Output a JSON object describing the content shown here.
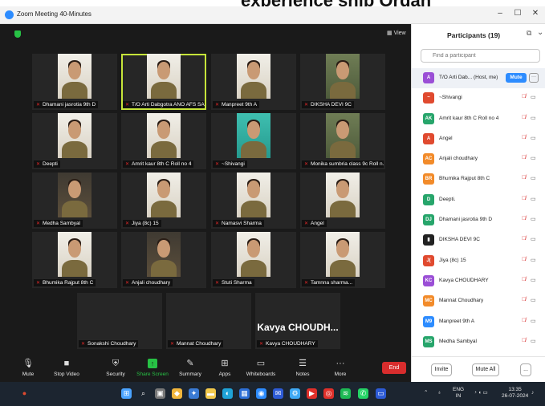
{
  "header_fragment": "experience ship Organ",
  "window": {
    "title": "Zoom Meeting 40-Minutes",
    "controls": [
      "–",
      "☐",
      "✕"
    ]
  },
  "view_label": "View",
  "tiles": [
    {
      "name": "Dhamani jasrotia 9th D",
      "bg": "light"
    },
    {
      "name": "T/O Arti Dabgotra ANO AFS SAMBA",
      "bg": "light",
      "active": true
    },
    {
      "name": "Manpreet 9th A",
      "bg": "light"
    },
    {
      "name": "DIKSHA DEVI 9C",
      "bg": "green"
    },
    {
      "name": "Deepti",
      "bg": "light"
    },
    {
      "name": "Amrit kaur 8th C Roll no 4",
      "bg": "light"
    },
    {
      "name": "~Shivangi",
      "bg": "teal"
    },
    {
      "name": "Monika sumbria class 9c Roll n...",
      "bg": "green"
    },
    {
      "name": "Medha Sambyal",
      "bg": "dark"
    },
    {
      "name": "Jiya (8c) 15",
      "bg": "light"
    },
    {
      "name": "Namasvi Sharma",
      "bg": "light"
    },
    {
      "name": "Angel",
      "bg": "light"
    },
    {
      "name": "Bhumika Rajput 8th C",
      "bg": "light"
    },
    {
      "name": "Anjali choudhary",
      "bg": "dark"
    },
    {
      "name": "Stuti Sharma",
      "bg": "light"
    },
    {
      "name": "Tamnna sharma...",
      "bg": "light"
    },
    {
      "name": "Sonakshi Choudhary",
      "bg": "none"
    },
    {
      "name": "Mannat Choudhary",
      "bg": "none"
    },
    {
      "name": "Kavya CHOUDHARY",
      "bg": "none",
      "big": "Kavya  CHOUDH..."
    }
  ],
  "toolbar": {
    "items": [
      {
        "label": "Mute",
        "icon": "🎙"
      },
      {
        "label": "Stop Video",
        "icon": "■"
      },
      {
        "label": "Security",
        "icon": "⛨"
      },
      {
        "label": "Share Screen",
        "icon": "↑"
      },
      {
        "label": "Summary",
        "icon": "✎"
      },
      {
        "label": "Apps",
        "icon": "⊞"
      },
      {
        "label": "Whiteboards",
        "icon": "▭"
      },
      {
        "label": "Notes",
        "icon": "☰"
      },
      {
        "label": "More",
        "icon": "···"
      }
    ],
    "end_label": "End"
  },
  "participants": {
    "title": "Participants (19)",
    "search_placeholder": "Find a participant",
    "host_name": "T/O Arti Dab...",
    "host_tag": "(Host, me)",
    "mute_label": "Mute",
    "list": [
      {
        "initials": "~",
        "name": "~Shivangi",
        "color": "#e04a2f"
      },
      {
        "initials": "AK",
        "name": "Amrit kaur 8th C Roll no 4",
        "color": "#27a56b"
      },
      {
        "initials": "A",
        "name": "Angel",
        "color": "#e04a2f"
      },
      {
        "initials": "AC",
        "name": "Anjali choudhary",
        "color": "#f28b2a"
      },
      {
        "initials": "BR",
        "name": "Bhumika Rajput 8th C",
        "color": "#f28b2a"
      },
      {
        "initials": "D",
        "name": "Deepti.",
        "color": "#27a56b"
      },
      {
        "initials": "DJ",
        "name": "Dhamani jasrotia 9th D",
        "color": "#27a56b"
      },
      {
        "initials": "▮",
        "name": "DIKSHA DEVI 9C",
        "color": "#222222"
      },
      {
        "initials": "J(",
        "name": "Jiya (8c) 15",
        "color": "#e04a2f"
      },
      {
        "initials": "KC",
        "name": "Kavya CHOUDHARY",
        "color": "#9b4fd6"
      },
      {
        "initials": "MC",
        "name": "Mannat Choudhary",
        "color": "#f28b2a"
      },
      {
        "initials": "M9",
        "name": "Manpreet 9th A",
        "color": "#2d8cff"
      },
      {
        "initials": "MS",
        "name": "Medha Sambyal",
        "color": "#27a56b"
      }
    ],
    "invite_label": "Invite",
    "mute_all_label": "Mute All",
    "more_label": "..."
  },
  "taskbar": {
    "lang_top": "ENG",
    "lang_bottom": "IN",
    "time": "13:35",
    "date": "26-07-2024"
  }
}
